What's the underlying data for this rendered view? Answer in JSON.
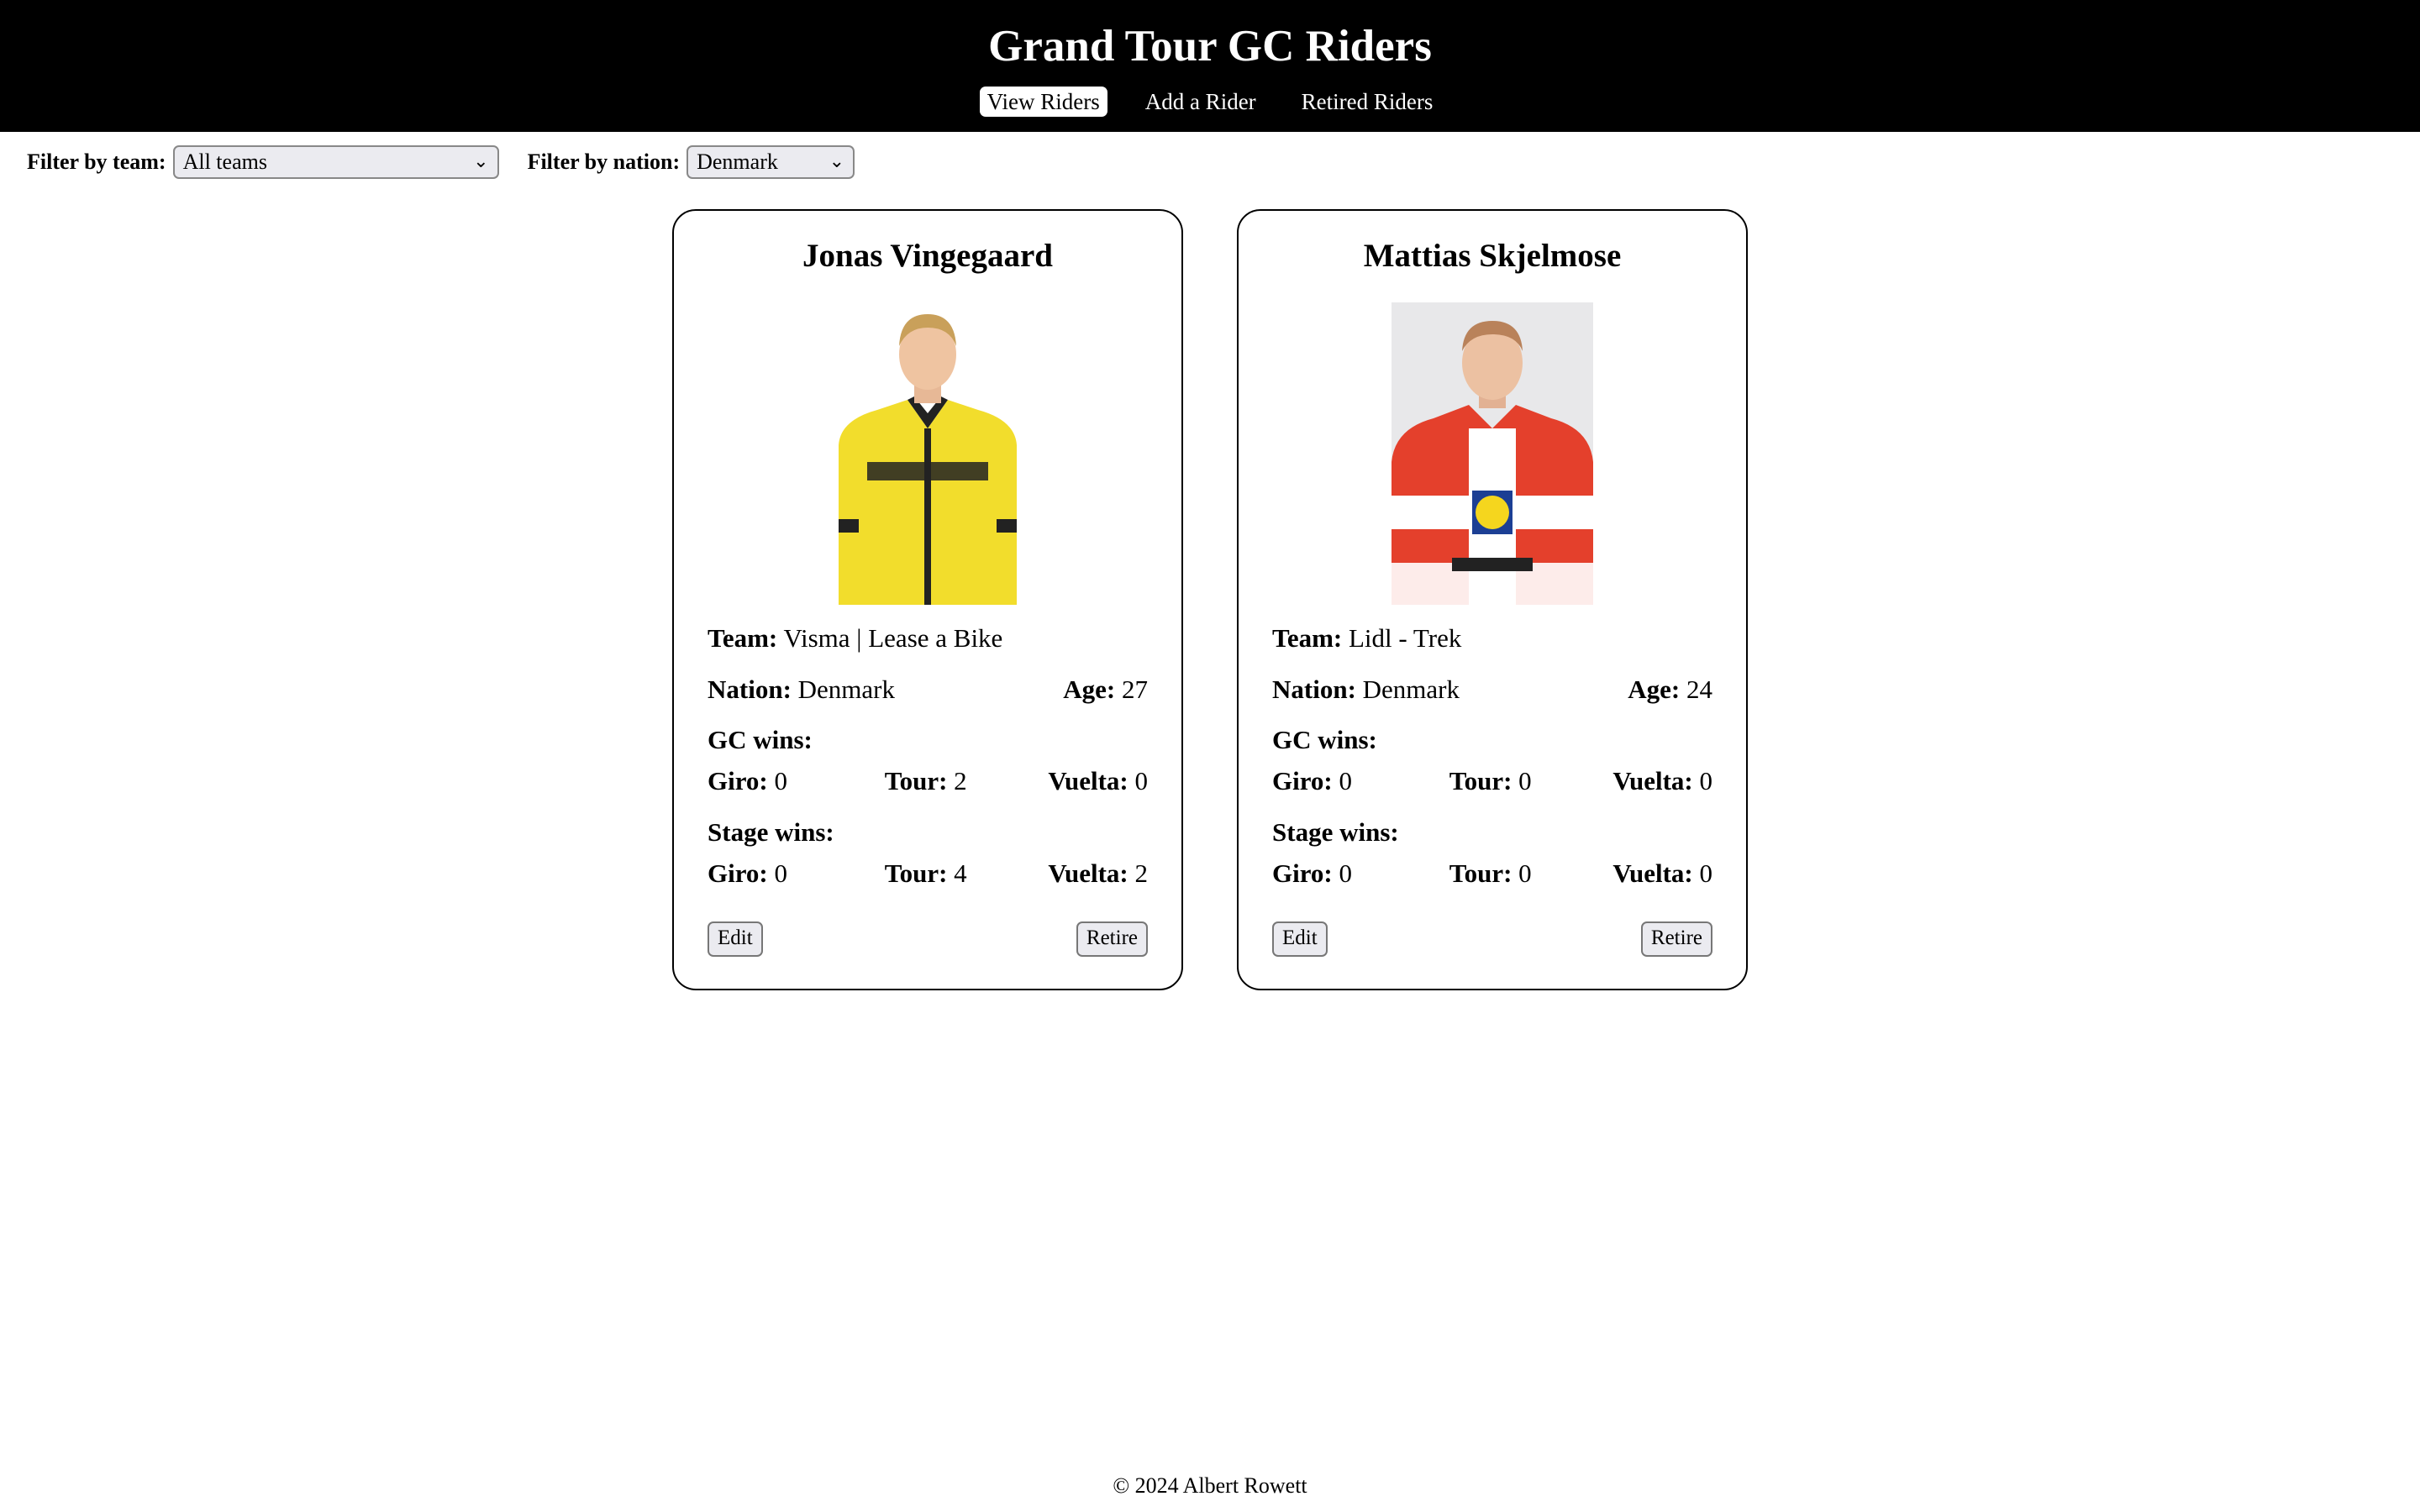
{
  "site": {
    "title": "Grand Tour GC Riders"
  },
  "nav": {
    "items": [
      "View Riders",
      "Add a Rider",
      "Retired Riders"
    ],
    "active_index": 0
  },
  "filters": {
    "team_label": "Filter by team:",
    "team_value": "All teams",
    "nation_label": "Filter by nation:",
    "nation_value": "Denmark"
  },
  "labels": {
    "team": "Team:",
    "nation": "Nation:",
    "age": "Age:",
    "gc_wins": "GC wins:",
    "stage_wins": "Stage wins:",
    "giro": "Giro:",
    "tour": "Tour:",
    "vuelta": "Vuelta:",
    "edit": "Edit",
    "retire": "Retire"
  },
  "riders": [
    {
      "name": "Jonas Vingegaard",
      "team": "Visma | Lease a Bike",
      "nation": "Denmark",
      "age": "27",
      "gc": {
        "giro": "0",
        "tour": "2",
        "vuelta": "0"
      },
      "stages": {
        "giro": "0",
        "tour": "4",
        "vuelta": "2"
      },
      "jersey_color": "#f2dd2c"
    },
    {
      "name": "Mattias Skjelmose",
      "team": "Lidl - Trek",
      "nation": "Denmark",
      "age": "24",
      "gc": {
        "giro": "0",
        "tour": "0",
        "vuelta": "0"
      },
      "stages": {
        "giro": "0",
        "tour": "0",
        "vuelta": "0"
      },
      "jersey_color": "#e4402c"
    }
  ],
  "footer": {
    "text": "© 2024 Albert Rowett"
  }
}
